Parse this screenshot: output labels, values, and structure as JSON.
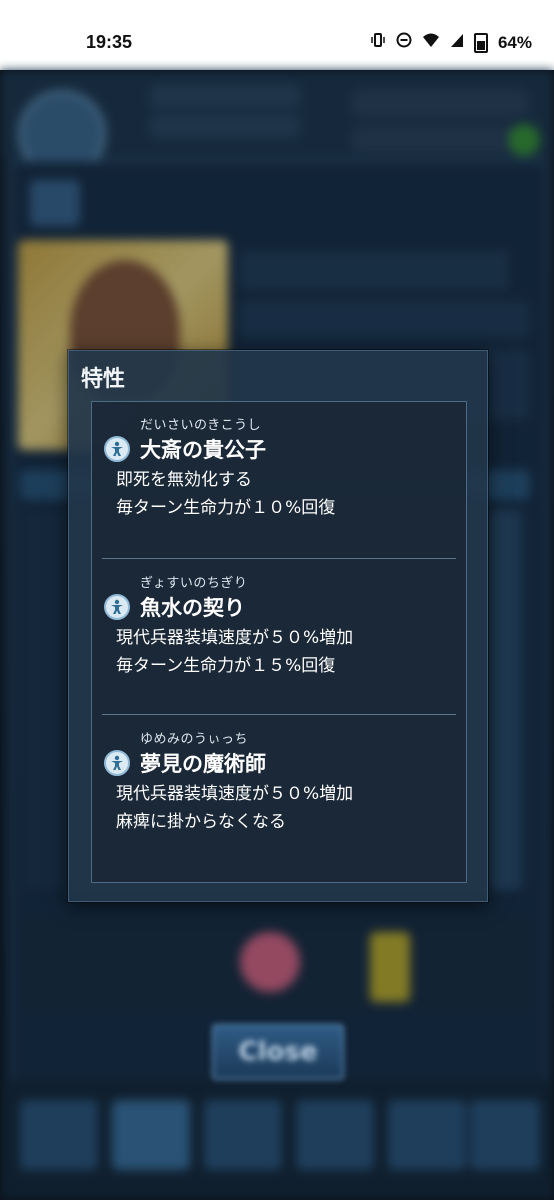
{
  "status_bar": {
    "time": "19:35",
    "icons": [
      "vibrate-icon",
      "dnd-icon",
      "wifi-icon",
      "signal-icon",
      "battery-icon"
    ],
    "battery_percent": "64%"
  },
  "dialog": {
    "title": "特性",
    "traits": [
      {
        "ruby": "だいさいのきこうし",
        "name": "大斎の貴公子",
        "descriptions": [
          "即死を無効化する",
          "毎ターン生命力が１０%回復"
        ]
      },
      {
        "ruby": "ぎょすいのちぎり",
        "name": "魚水の契り",
        "descriptions": [
          "現代兵器装填速度が５０%増加",
          "毎ターン生命力が１５%回復"
        ]
      },
      {
        "ruby": "ゆめみのうぃっち",
        "name": "夢見の魔術師",
        "descriptions": [
          "現代兵器装填速度が５０%増加",
          "麻痺に掛からなくなる"
        ]
      }
    ]
  },
  "close_button": {
    "label": "Close"
  },
  "colors": {
    "dialog_bg": "#22364a",
    "panel_border": "#4d6a86",
    "text": "#ffffff"
  }
}
